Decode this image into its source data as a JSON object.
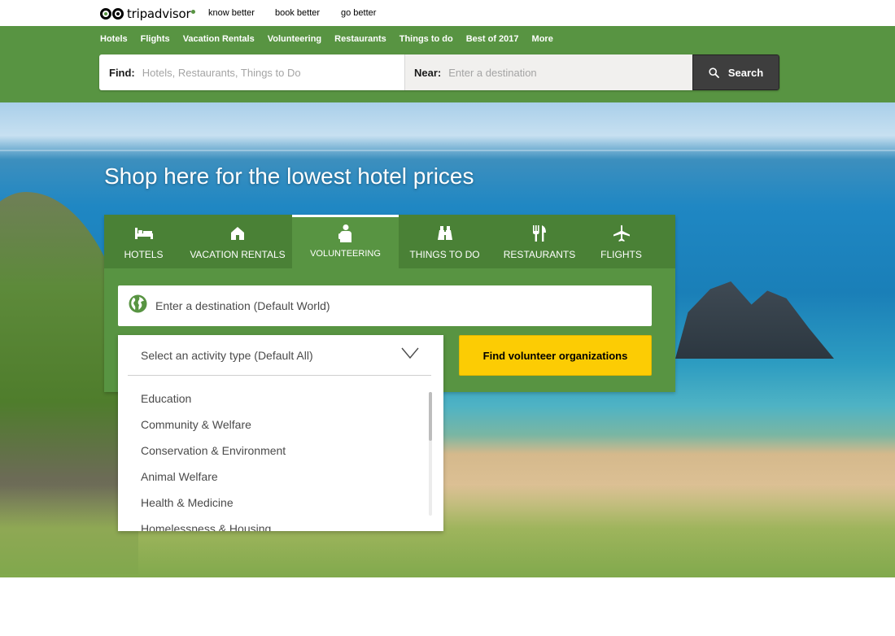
{
  "header": {
    "brand": "tripadvisor",
    "taglines": [
      "know better",
      "book better",
      "go better"
    ]
  },
  "nav": {
    "links": [
      "Hotels",
      "Flights",
      "Vacation Rentals",
      "Volunteering",
      "Restaurants",
      "Things to do",
      "Best of 2017",
      "More"
    ]
  },
  "search": {
    "find_label": "Find:",
    "find_placeholder": "Hotels, Restaurants, Things to Do",
    "near_label": "Near:",
    "near_placeholder": "Enter a destination",
    "button_label": "Search"
  },
  "hero": {
    "title": "Shop here for the lowest hotel prices"
  },
  "tabs": [
    {
      "label": "HOTELS",
      "icon": "bed-icon"
    },
    {
      "label": "VACATION RENTALS",
      "icon": "house-icon"
    },
    {
      "label": "VOLUNTEERING",
      "icon": "volunteer-icon",
      "active": true
    },
    {
      "label": "THINGS TO DO",
      "icon": "binoculars-icon"
    },
    {
      "label": "RESTAURANTS",
      "icon": "fork-knife-icon"
    },
    {
      "label": "FLIGHTS",
      "icon": "plane-icon"
    }
  ],
  "volunteer": {
    "destination_text": "Enter a destination  (Default World)",
    "activity_text": "Select an activity type  (Default All)",
    "activity_options": [
      "Education",
      "Community & Welfare",
      "Conservation & Environment",
      "Animal Welfare",
      "Health & Medicine",
      "Homelessness & Housing"
    ],
    "find_button": "Find volunteer organizations"
  },
  "colors": {
    "brand_green": "#589442",
    "tab_bar_green": "#4a8136",
    "cta_yellow": "#fccc04",
    "search_button": "#3e3e3e"
  }
}
